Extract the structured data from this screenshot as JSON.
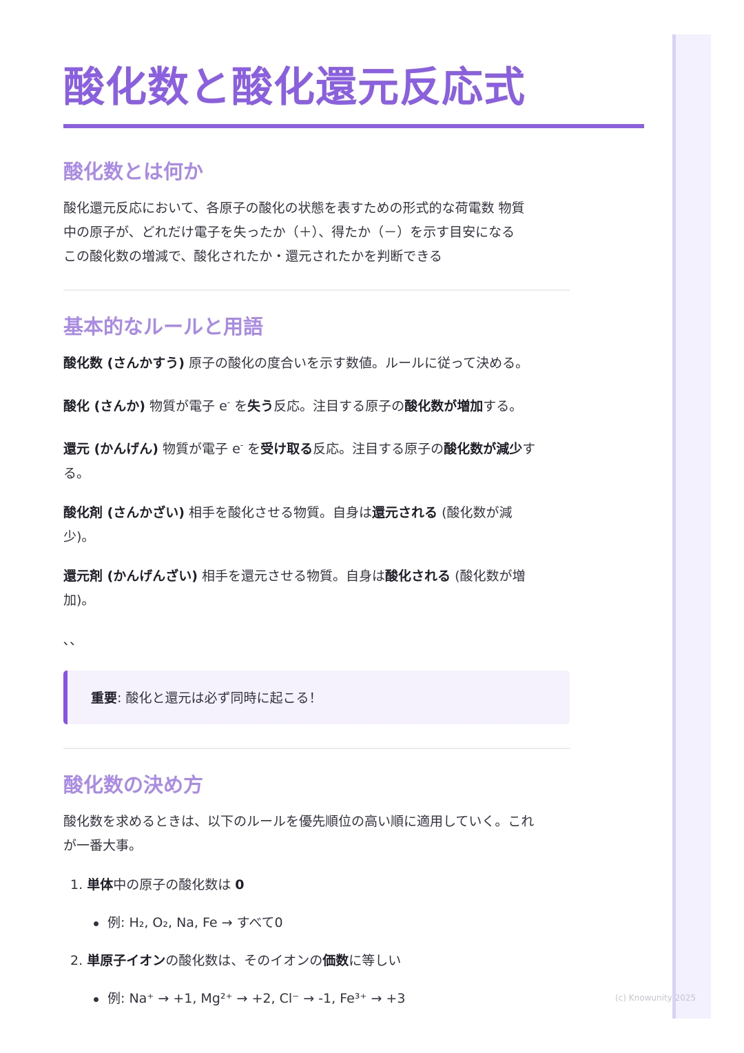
{
  "title": "酸化数と酸化還元反応式",
  "footer": {
    "copyright": "(c) Knowunity 2025"
  },
  "section1": {
    "heading": "酸化数とは何か",
    "lines": [
      "酸化還元反応において、各原子の酸化の状態を表すための形式的な荷電数 物質",
      "中の原子が、どれだけ電子を失ったか（＋）、得たか（－）を示す目安になる",
      "この酸化数の増減で、酸化されたか・還元されたかを判断できる"
    ]
  },
  "section2": {
    "heading": "基本的なルールと用語",
    "def1": {
      "term": "酸化数 (さんかすう)",
      "text": " 原子の酸化の度合いを示す数値。ルールに従って決める。"
    },
    "def2": {
      "term": "酸化 (さんか)",
      "t1": " 物質が電子 e",
      "sup": "-",
      "t2": " を",
      "b1": "失う",
      "t3": "反応。注目する原子の",
      "b2": "酸化数が増加",
      "t4": "する。"
    },
    "def3": {
      "term": "還元 (かんげん)",
      "t1": " 物質が電子 e",
      "sup": "-",
      "t2": " を",
      "b1": "受け取る",
      "t3": "反応。注目する原子の",
      "b2": "酸化数が減少",
      "t4": "す",
      "line2": "る。"
    },
    "def4": {
      "term": "酸化剤 (さんかざい)",
      "t1": " 相手を酸化させる物質。自身は",
      "b1": "還元される",
      "t2": " (酸化数が減",
      "line2": "少)。"
    },
    "def5": {
      "term": "還元剤 (かんげんざい)",
      "t1": " 相手を還元させる物質。自身は",
      "b1": "酸化される",
      "t2": " (酸化数が増",
      "line2": "加)。"
    },
    "ticks": "､､",
    "note": {
      "label": "重要",
      "text": ": 酸化と還元は必ず同時に起こる！"
    }
  },
  "section3": {
    "heading": "酸化数の決め方",
    "intro": [
      "酸化数を求めるときは、以下のルールを優先順位の高い順に適用していく。これ",
      "が一番大事。"
    ],
    "rule1": {
      "num": "1.",
      "bold": "単体",
      "text": "中の原子の酸化数は ",
      "value": "0"
    },
    "rule1_example": "例: H₂, O₂, Na, Fe → すべて0",
    "rule2": {
      "num": "2.",
      "bold": "単原子イオン",
      "text": "の酸化数は、そのイオンの",
      "bold2": "価数",
      "text2": "に等しい"
    },
    "rule2_example": "例: Na⁺ → +1, Mg²⁺ → +2, Cl⁻ → -1, Fe³⁺ → +3"
  }
}
